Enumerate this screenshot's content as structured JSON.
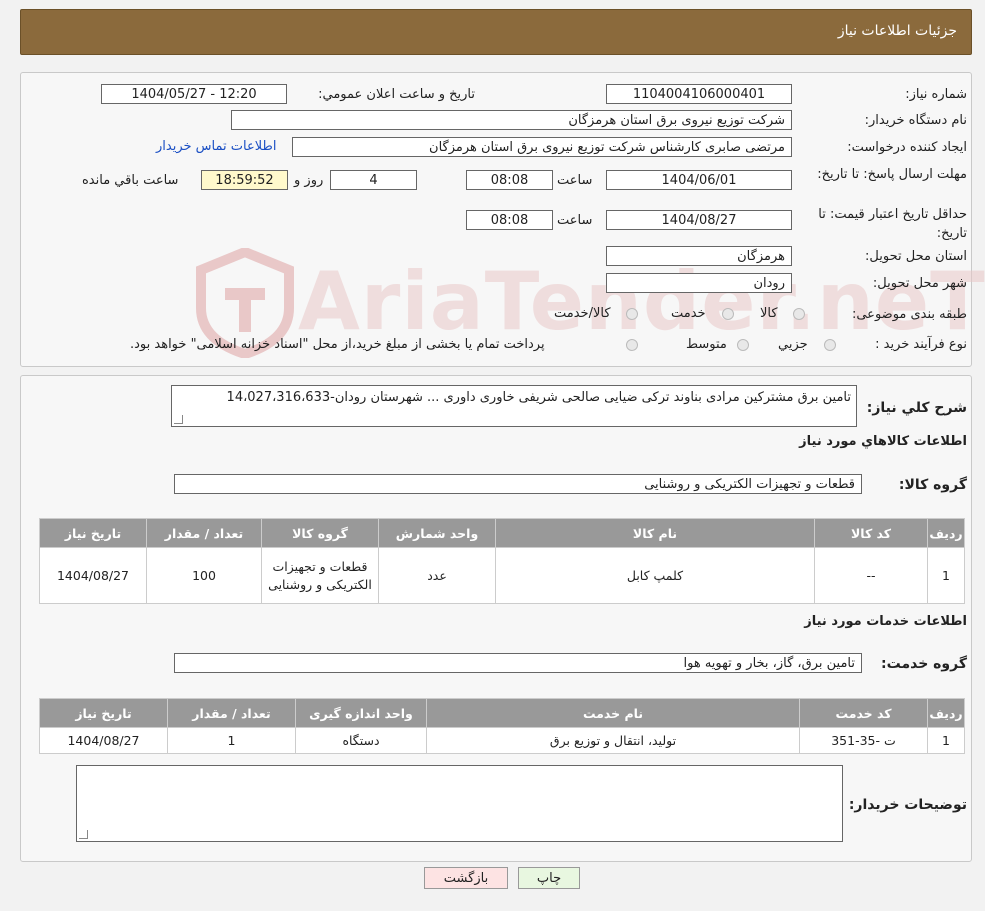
{
  "header": {
    "title": "جزئیات اطلاعات نیاز"
  },
  "watermark": {
    "text": "AriaTender.neT"
  },
  "details": {
    "need_number_label": "شماره نیاز:",
    "need_number": "1104004106000401",
    "announce_label": "تاریخ و ساعت اعلان عمومي:",
    "announce_value": "1404/05/27 - 12:20",
    "buyer_label": "نام دستگاه خریدار:",
    "buyer_value": "شرکت توزیع نیروی برق استان هرمزگان",
    "creator_label": "ایجاد کننده درخواست:",
    "creator_value": "مرتضی صابری کارشناس شرکت توزیع نیروی برق استان هرمزگان",
    "contact_link": "اطلاعات تماس خریدار",
    "deadline_label": "مهلت ارسال پاسخ: تا تاریخ:",
    "deadline_date": "1404/06/01",
    "hour_label": "ساعت",
    "deadline_time": "08:08",
    "days_value": "4",
    "days_label": "روز و",
    "remaining_time": "18:59:52",
    "remaining_label": "ساعت باقي مانده",
    "validity_label": "حداقل تاریخ اعتبار قیمت: تا تاریخ:",
    "validity_date": "1404/08/27",
    "validity_time": "08:08",
    "province_label": "استان محل تحویل:",
    "province_value": "هرمزگان",
    "city_label": "شهر محل تحویل:",
    "city_value": "رودان",
    "category_label": "طبقه بندی موضوعی:",
    "category_options": [
      "کالا",
      "خدمت",
      "کالا/خدمت"
    ],
    "process_label": "نوع فرآیند خرید :",
    "process_options": [
      "جزیي",
      "متوسط"
    ],
    "process_note": "پرداخت تمام یا بخشی از مبلغ خرید،از محل \"اسناد خزانه اسلامی\" خواهد بود."
  },
  "summary": {
    "label": "شرح کلي نیاز:",
    "text": "تامین برق مشترکین مرادی بناوند ترکی ضیایی صالحی شریفی خاوری داوری ... شهرستان رودان-14،027،316،633"
  },
  "goods": {
    "section_title": "اطلاعات کالاهاي مورد نیاز",
    "group_label": "گروه کالا:",
    "group_value": "قطعات و تجهیزات الکتریکی و روشنایی",
    "headers": [
      "ردیف",
      "کد کالا",
      "نام کالا",
      "واحد شمارش",
      "گروه کالا",
      "تعداد / مقدار",
      "تاریخ نیاز"
    ],
    "rows": [
      [
        "1",
        "--",
        "کلمپ کابل",
        "عدد",
        "قطعات و تجهیزات الکتریکی و روشنایی",
        "100",
        "1404/08/27"
      ]
    ]
  },
  "services": {
    "section_title": "اطلاعات خدمات مورد نیاز",
    "group_label": "گروه خدمت:",
    "group_value": "تامین برق، گاز، بخار و تهویه هوا",
    "headers": [
      "ردیف",
      "کد خدمت",
      "نام خدمت",
      "واحد اندازه گیری",
      "تعداد / مقدار",
      "تاریخ نیاز"
    ],
    "rows": [
      [
        "1",
        "ت -35-351",
        "تولید، انتقال و توزیع برق",
        "دستگاه",
        "1",
        "1404/08/27"
      ]
    ]
  },
  "buyer_notes": {
    "label": "توضیحات خریدار:",
    "value": ""
  },
  "buttons": {
    "print": "چاپ",
    "back": "بازگشت"
  },
  "colors": {
    "header_bg": "#8b6a3c",
    "table_header": "#999999",
    "back_btn": "#fde3e3",
    "print_btn": "#e8f7e0"
  }
}
